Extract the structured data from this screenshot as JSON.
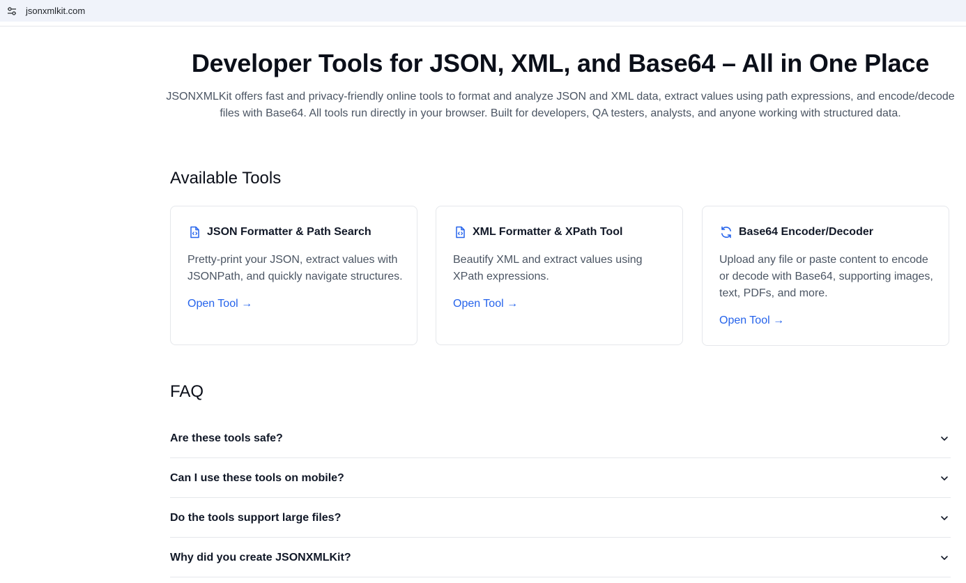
{
  "browser": {
    "url": "jsonxmlkit.com",
    "site_info_icon": "tune-icon"
  },
  "hero": {
    "title": "Developer Tools for JSON, XML, and Base64 – All in One Place",
    "description": "JSONXMLKit offers fast and privacy-friendly online tools to format and analyze JSON and XML data, extract values using path expressions, and encode/decode files with Base64. All tools run directly in your browser. Built for developers, QA testers, analysts, and anyone working with structured data."
  },
  "tools": {
    "title": "Available Tools",
    "items": [
      {
        "icon": "file-code-icon",
        "title": "JSON Formatter & Path Search",
        "description": "Pretty-print your JSON, extract values with JSONPath, and quickly navigate structures.",
        "link": "Open Tool →"
      },
      {
        "icon": "file-code-icon",
        "title": "XML Formatter & XPath Tool",
        "description": "Beautify XML and extract values using XPath expressions.",
        "link": "Open Tool →"
      },
      {
        "icon": "refresh-icon",
        "title": "Base64 Encoder/Decoder",
        "description": "Upload any file or paste content to encode or decode with Base64, supporting images, text, PDFs, and more.",
        "link": "Open Tool →"
      }
    ]
  },
  "faq": {
    "title": "FAQ",
    "items": [
      {
        "question": "Are these tools safe?"
      },
      {
        "question": "Can I use these tools on mobile?"
      },
      {
        "question": "Do the tools support large files?"
      },
      {
        "question": "Why did you create JSONXMLKit?"
      }
    ]
  },
  "colors": {
    "accent": "#2563eb",
    "text": "#111827",
    "muted": "#4b5563",
    "border": "#e5e7eb",
    "address_bar": "#f0f3fa"
  }
}
